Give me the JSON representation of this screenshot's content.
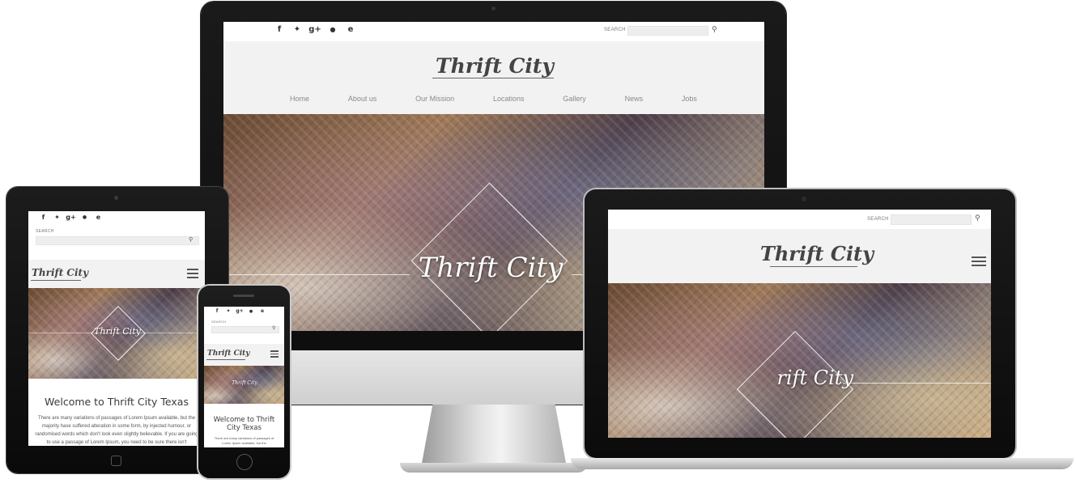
{
  "brand": {
    "logo_text": "Thrift City",
    "hero_title": "Thrift City"
  },
  "social_icons": [
    {
      "name": "facebook-icon",
      "glyph": "f"
    },
    {
      "name": "twitter-icon",
      "glyph": "🐦"
    },
    {
      "name": "google-plus-icon",
      "glyph": "g+"
    },
    {
      "name": "apple-icon",
      "glyph": "●"
    },
    {
      "name": "ie-icon",
      "glyph": "e"
    }
  ],
  "search": {
    "label": "SEARCH",
    "icon": "search-icon",
    "glyph": "⚲"
  },
  "nav": {
    "items": [
      "Home",
      "About us",
      "Our Mission",
      "Locations",
      "Gallery",
      "News",
      "Jobs"
    ]
  },
  "welcome": {
    "heading": "Welcome to Thrift City Texas",
    "body_tablet": "There are many variations of passages of Lorem Ipsum available, but the majority have suffered alteration in some form, by injected humour, or randomised words which don't look even slightly believable. If you are going to use a passage of Lorem Ipsum, you need to be sure there isn't",
    "body_phone": "There are many variations of passages of Lorem Ipsum available, but the"
  },
  "colors": {
    "device_black": "#111111",
    "topbar": "#ffffff",
    "header_band": "#f2f2f2",
    "nav_text": "#8a8a8a",
    "stand_silver": "#c8c8c8"
  }
}
